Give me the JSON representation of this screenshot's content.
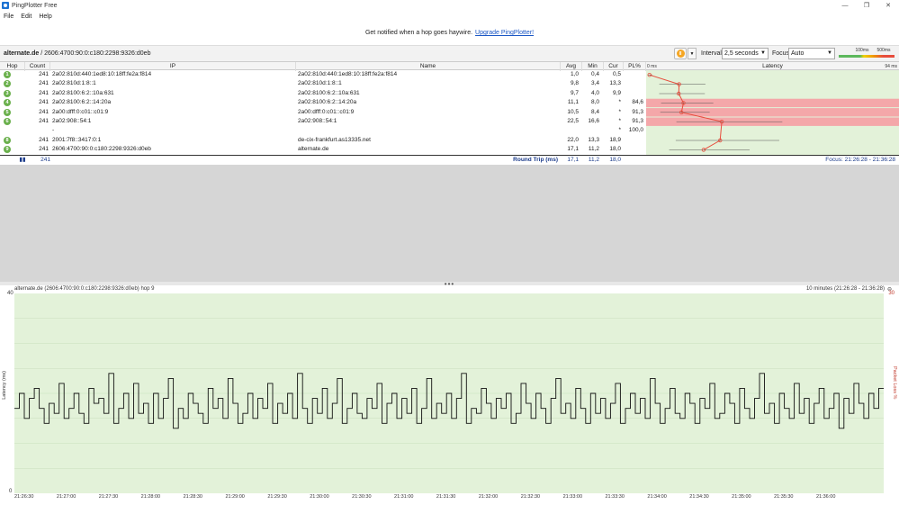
{
  "window": {
    "title": "PingPlotter Free",
    "minimize": "—",
    "maximize": "❐",
    "close": "✕"
  },
  "menu": [
    "File",
    "Edit",
    "Help"
  ],
  "banner": {
    "text": "Get notified when a hop goes haywire.",
    "link": "Upgrade PingPlotter!"
  },
  "toolbar": {
    "target_name": "alternate.de",
    "target_ip": " / 2606:4700:90:0:c180:2298:9326:d0eb",
    "pause_icon": "pause-icon",
    "interval_label": "Interval",
    "interval_value": "2,5 seconds",
    "focus_label": "Focus",
    "focus_value": "Auto",
    "scale_100": "100ms",
    "scale_500": "500ms"
  },
  "table": {
    "headers": {
      "hop": "Hop",
      "count": "Count",
      "ip": "IP",
      "name": "Name",
      "avg": "Avg",
      "min": "Min",
      "cur": "Cur",
      "pl": "PL%",
      "latency": "Latency",
      "lat_min": "0 ms",
      "lat_max": "94 ms"
    },
    "rows": [
      {
        "hop": "1",
        "count": "241",
        "ip": "2a02:810d:440:1ed8:10:18ff:fe2a:f814",
        "name": "2a02:810d:440:1ed8:10:18ff:fe2a:f814",
        "avg": "1,0",
        "min": "0,4",
        "cur": "0,5",
        "pl": ""
      },
      {
        "hop": "2",
        "count": "241",
        "ip": "2a02:810d:1:8::1",
        "name": "2a02:810d:1:8::1",
        "avg": "9,8",
        "min": "3,4",
        "cur": "13,3",
        "pl": ""
      },
      {
        "hop": "3",
        "count": "241",
        "ip": "2a02:8100:6:2::10a:631",
        "name": "2a02:8100:6:2::10a:631",
        "avg": "9,7",
        "min": "4,0",
        "cur": "9,9",
        "pl": ""
      },
      {
        "hop": "4",
        "count": "241",
        "ip": "2a02:8100:6:2::14:20a",
        "name": "2a02:8100:6:2::14:20a",
        "avg": "11,1",
        "min": "8,0",
        "cur": "*",
        "pl": "84,6"
      },
      {
        "hop": "5",
        "count": "241",
        "ip": "2a00:dfff:0:c01::c01:9",
        "name": "2a00:dfff:0:c01::c01:9",
        "avg": "10,5",
        "min": "8,4",
        "cur": "*",
        "pl": "91,3"
      },
      {
        "hop": "6",
        "count": "241",
        "ip": "2a02:908::54:1",
        "name": "2a02:908::54:1",
        "avg": "22,5",
        "min": "16,6",
        "cur": "*",
        "pl": "91,3"
      },
      {
        "hop": "",
        "count": "",
        "ip": "-",
        "name": "",
        "avg": "",
        "min": "",
        "cur": "*",
        "pl": "100,0"
      },
      {
        "hop": "8",
        "count": "241",
        "ip": "2001:7f8::3417:0:1",
        "name": "de-cix-frankfurt.as13335.net",
        "avg": "22,0",
        "min": "13,3",
        "cur": "18,9",
        "pl": ""
      },
      {
        "hop": "9",
        "count": "241",
        "ip": "2606:4700:90:0:c180:2298:9326:d0eb",
        "name": "alternate.de",
        "avg": "17,1",
        "min": "11,2",
        "cur": "18,0",
        "pl": ""
      }
    ],
    "summary": {
      "count": "241",
      "label": "Round Trip (ms)",
      "avg": "17,1",
      "min": "11,2",
      "cur": "18,0",
      "focus": "Focus: 21:26:28 - 21:36:28"
    },
    "latency_chart": {
      "points_ms": [
        1.0,
        9.8,
        9.7,
        11.1,
        10.5,
        22.5,
        22.0,
        17.1
      ],
      "row_index": [
        0,
        1,
        2,
        3,
        4,
        5,
        7,
        8
      ],
      "range_ms": [
        0,
        94
      ],
      "pl_rows": [
        3,
        4,
        5
      ],
      "pl_color": "#f4a7a9",
      "line_color": "#e74c3c"
    }
  },
  "timeline": {
    "title": "alternate.de (2606:4700:90:0:c180:2298:9326:d0eb) hop 9",
    "range": "10 minutes (21:26:28 - 21:36:28)",
    "y_left_label": "Latency (ms)",
    "y_right_label": "Packet Loss %",
    "y_max": "40",
    "y_min": "0",
    "y_right_max": "30",
    "xticks": [
      "21:26:30",
      "21:27:00",
      "21:27:30",
      "21:28:00",
      "21:28:30",
      "21:29:00",
      "21:29:30",
      "21:30:00",
      "21:30:30",
      "21:31:00",
      "21:31:30",
      "21:32:00",
      "21:32:30",
      "21:33:00",
      "21:33:30",
      "21:34:00",
      "21:34:30",
      "21:35:00",
      "21:35:30",
      "21:36:00"
    ]
  },
  "chart_data": {
    "type": "line",
    "title": "alternate.de (2606:4700:90:0:c180:2298:9326:d0eb) hop 9",
    "ylabel": "Latency (ms)",
    "y2label": "Packet Loss %",
    "ylim": [
      0,
      40
    ],
    "y2lim": [
      0,
      30
    ],
    "x": [
      "21:26:30",
      "21:27:00",
      "21:27:30",
      "21:28:00",
      "21:28:30",
      "21:29:00",
      "21:29:30",
      "21:30:00",
      "21:30:30",
      "21:31:00",
      "21:31:30",
      "21:32:00",
      "21:32:30",
      "21:33:00",
      "21:33:30",
      "21:34:00",
      "21:34:30",
      "21:35:00",
      "21:35:30",
      "21:36:00"
    ],
    "series": [
      {
        "values": [
          17,
          20,
          15,
          19,
          21,
          17,
          14,
          18,
          16,
          22,
          15,
          17,
          20,
          16,
          14,
          21,
          18,
          19,
          16,
          24,
          14,
          17,
          20,
          15,
          22,
          16,
          18,
          14,
          20,
          15,
          19,
          23,
          13,
          17,
          15,
          20,
          18,
          16,
          14,
          21,
          17,
          19,
          15,
          23,
          18,
          14,
          16,
          20,
          15,
          19,
          17,
          22,
          14,
          18,
          16,
          20,
          15,
          24,
          17,
          14,
          19,
          16,
          21,
          15,
          18,
          23,
          14,
          17,
          20,
          16,
          15,
          19,
          17,
          22,
          14,
          18,
          20,
          15,
          19,
          16,
          21,
          14,
          17,
          23,
          15,
          18,
          16,
          20,
          15,
          19,
          24,
          14,
          17,
          16,
          21,
          18,
          15,
          19,
          17,
          20,
          14,
          16,
          22,
          18,
          15,
          20,
          17,
          14,
          19,
          23,
          16,
          18,
          15,
          21,
          17,
          14,
          20,
          16,
          19,
          15,
          18,
          22,
          14,
          17,
          20,
          16,
          19,
          15,
          23,
          18,
          14,
          17,
          21,
          16,
          15,
          20,
          18,
          14,
          19,
          17,
          22,
          15,
          16,
          20,
          18,
          14,
          21,
          17,
          15,
          19,
          24,
          16,
          18,
          14,
          20,
          17,
          15,
          22,
          16,
          19,
          14,
          18,
          21,
          15,
          17,
          20,
          13,
          19,
          16,
          22,
          18,
          15,
          20,
          17,
          21
        ],
        "color": "#111111"
      }
    ],
    "grid": true,
    "background": "#e3f2d9"
  }
}
